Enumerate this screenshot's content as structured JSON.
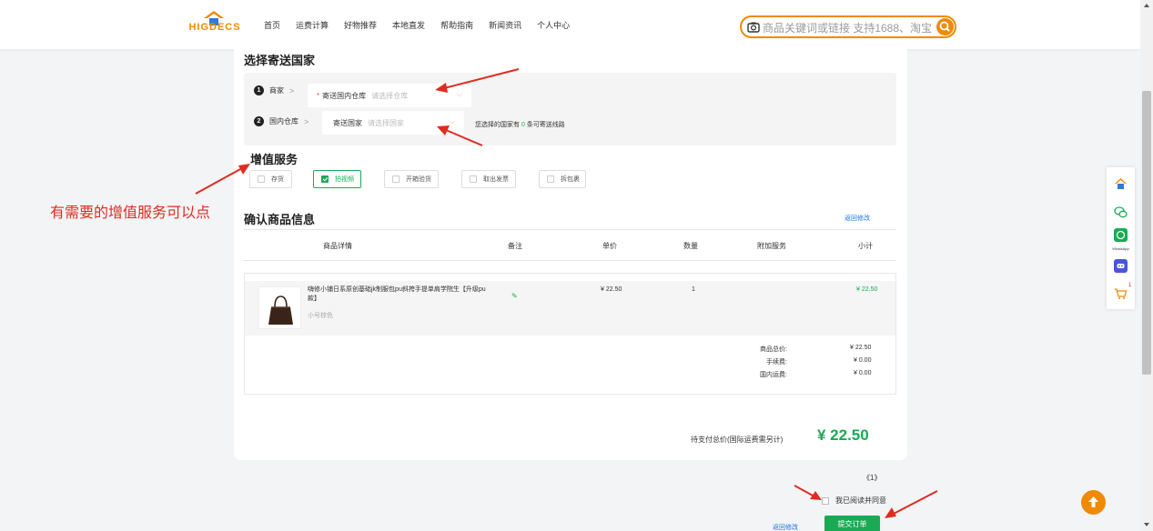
{
  "header": {
    "logo_text": "HIGDECS",
    "nav": [
      "首页",
      "运费计算",
      "好物推荐",
      "本地直发",
      "帮助指南",
      "新闻资讯",
      "个人中心"
    ],
    "search_placeholder": "商品关键词或链接 支持1688、淘宝"
  },
  "country": {
    "title": "选择寄送国家",
    "step1": {
      "num": "1",
      "label": "商家",
      "required_mark": "*",
      "field_label": "寄送国内仓库",
      "placeholder": "请选择仓库"
    },
    "step2": {
      "num": "2",
      "label": "国内仓库",
      "field_label": "寄送国家",
      "placeholder": "请选择国家"
    },
    "hint_before": "您选择的国家有",
    "hint_count": "0",
    "hint_after": "条可寄送线路"
  },
  "services": {
    "title": "增值服务",
    "items": [
      {
        "label": "存货",
        "checked": false
      },
      {
        "label": "拍视频",
        "checked": true
      },
      {
        "label": "开箱验货",
        "checked": false
      },
      {
        "label": "取出发票",
        "checked": false
      },
      {
        "label": "拆包裹",
        "checked": false
      }
    ]
  },
  "annotation": "有需要的增值服务可以点",
  "order": {
    "title": "确认商品信息",
    "back_link": "返回修改",
    "columns": [
      "商品详情",
      "备注",
      "单价",
      "数量",
      "附加服务",
      "小计"
    ],
    "item": {
      "name": "嗨修小铺日系原创基础jk制服包pu斜挎手提单肩学院生【升级pu款】",
      "variant": "小号棕色",
      "price": "¥ 22.50",
      "quantity": "1",
      "subtotal": "¥ 22.50"
    },
    "summary": [
      {
        "label": "商品总价:",
        "value": "¥ 22.50"
      },
      {
        "label": "手续费:",
        "value": "¥ 0.00"
      },
      {
        "label": "国内运费:",
        "value": "¥ 0.00"
      }
    ],
    "total_label": "待支付总价(国际运费需另计)",
    "total_value": "¥ 22.50"
  },
  "footer": {
    "pager": "《1》",
    "agree_label": "我已阅读并同意",
    "back_link": "返回修改",
    "submit_label": "提交订单"
  },
  "sidebar": {
    "whatsapp_label": "WhatsApp",
    "cart_badge": "1"
  },
  "colors": {
    "brand_orange": "#f08a00",
    "accent_green": "#1aaa55",
    "annotation_red": "#e02b20",
    "link_blue": "#1a73e8"
  }
}
